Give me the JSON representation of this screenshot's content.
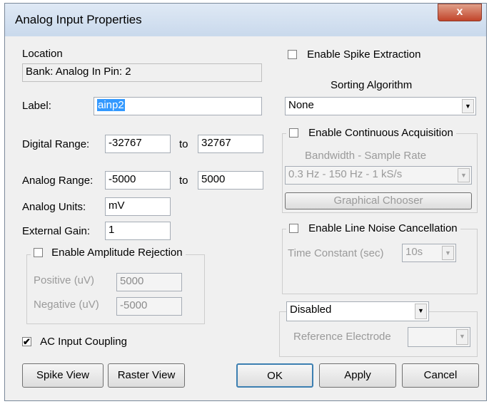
{
  "window": {
    "title": "Analog Input Properties",
    "close_glyph": "x"
  },
  "left": {
    "location_label": "Location",
    "location_value": "Bank: Analog In  Pin: 2",
    "label_label": "Label:",
    "label_value": "ainp2",
    "digital_range_label": "Digital Range:",
    "digital_min": "-32767",
    "digital_to": "to",
    "digital_max": "32767",
    "analog_range_label": "Analog Range:",
    "analog_min": "-5000",
    "analog_to": "to",
    "analog_max": "5000",
    "analog_units_label": "Analog Units:",
    "analog_units_value": "mV",
    "external_gain_label": "External Gain:",
    "external_gain_value": "1",
    "amplitude_rejection": {
      "label": "Enable Amplitude Rejection",
      "checked": false,
      "positive_label": "Positive (uV)",
      "positive_value": "5000",
      "negative_label": "Negative (uV)",
      "negative_value": "-5000"
    },
    "ac_coupling": {
      "label": "AC Input Coupling",
      "checked": true,
      "check_glyph": "✔"
    }
  },
  "right": {
    "spike_extraction": {
      "label": "Enable Spike Extraction",
      "checked": false
    },
    "sorting_label": "Sorting Algorithm",
    "sorting_value": "None",
    "continuous": {
      "label": "Enable Continuous Acquisition",
      "checked": false,
      "bandwidth_label": "Bandwidth - Sample Rate",
      "bandwidth_value": "0.3 Hz - 150 Hz  - 1 kS/s",
      "chooser_button": "Graphical Chooser"
    },
    "line_noise": {
      "label": "Enable Line Noise Cancellation",
      "checked": false,
      "time_constant_label": "Time Constant (sec)",
      "time_constant_value": "10s"
    },
    "reference": {
      "mode_value": "Disabled",
      "electrode_label": "Reference Electrode",
      "electrode_value": ""
    }
  },
  "buttons": {
    "spike_view": "Spike View",
    "raster_view": "Raster View",
    "ok": "OK",
    "apply": "Apply",
    "cancel": "Cancel"
  },
  "icons": {
    "dropdown": "▼"
  },
  "colors": {
    "selection": "#3399ff",
    "titlebar": "#c9d9ec",
    "close_button": "#c2442a"
  }
}
